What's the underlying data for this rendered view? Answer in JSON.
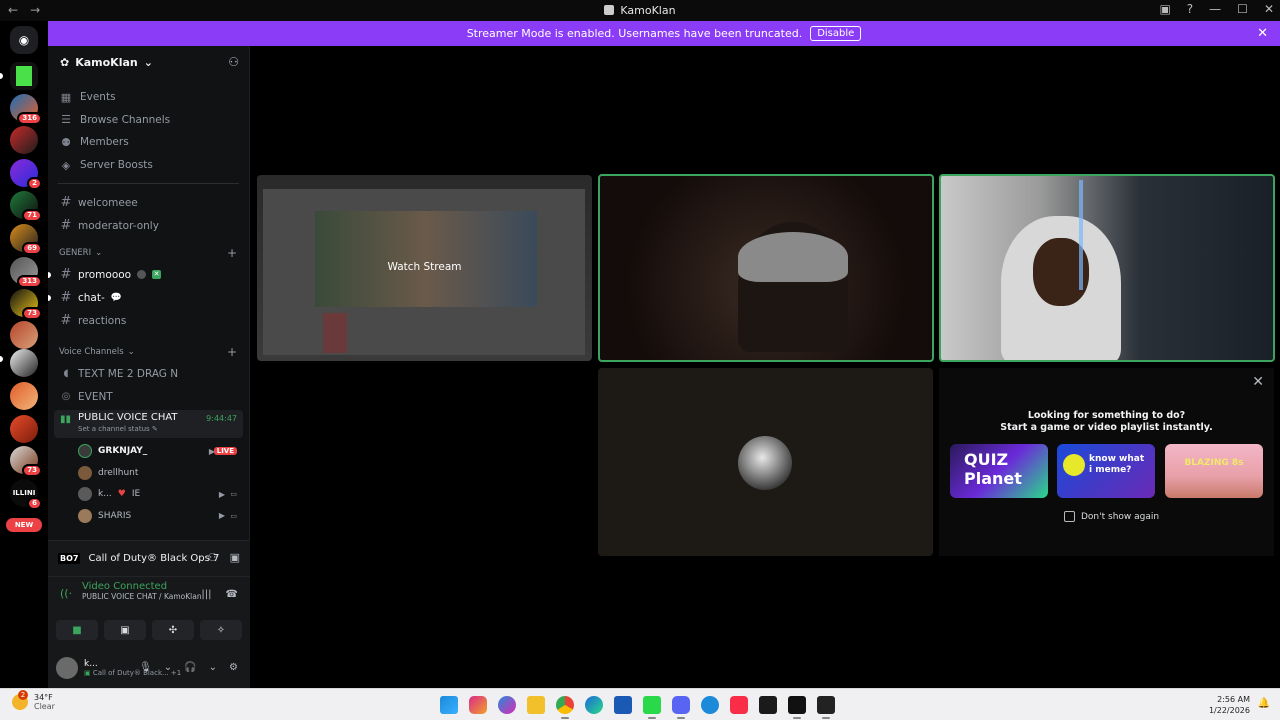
{
  "window": {
    "title": "KamoKlan"
  },
  "banner": {
    "text": "Streamer Mode is enabled. Usernames have been truncated.",
    "button": "Disable"
  },
  "server": {
    "name": "KamoKlan",
    "nav": [
      "Events",
      "Browse Channels",
      "Members",
      "Server Boosts"
    ]
  },
  "channels_top": [
    "welcomeee",
    "moderator-only"
  ],
  "category_text": {
    "name": "GENERI",
    "channels": [
      "promoooo",
      "chat-",
      "reactions"
    ]
  },
  "category_voice": {
    "name": "Voice Channels",
    "channels": [
      "TEXT ME 2 DRAG N",
      "EVENT"
    ]
  },
  "active_voice": {
    "name": "PUBLIC VOICE CHAT",
    "timer": "9:44:47",
    "status": "Set a channel status"
  },
  "voice_users": [
    {
      "name": "GRKNJAY_",
      "live": "LIVE"
    },
    {
      "name": "drellhunt"
    },
    {
      "name": "k...",
      "tag": "IE"
    },
    {
      "name": "SHARIS"
    }
  ],
  "server_badges": [
    "316",
    "2",
    "71",
    "69",
    "313",
    "73",
    "73",
    "6"
  ],
  "new_pill": "NEW",
  "game": {
    "name": "Call of Duty® Black Ops 7",
    "icon": "BO7"
  },
  "voice_connection": {
    "status": "Video Connected",
    "detail": "PUBLIC VOICE CHAT / KamoKlan"
  },
  "me": {
    "name": "k...",
    "activity": "Call of Duty® Black...",
    "extra": "+1"
  },
  "stage": {
    "watch_label": "Watch Stream"
  },
  "activity_prompt": {
    "line1": "Looking for something to do?",
    "line2": "Start a game or video playlist instantly.",
    "dont_show": "Don't show again",
    "cards": [
      "QUIZ Planet",
      "know what i meme?",
      "BLAZING 8s"
    ]
  },
  "taskbar": {
    "weather_temp": "34°F",
    "weather_desc": "Clear",
    "weather_badge": "2",
    "time": "2:56 AM",
    "date": "1/22/2026"
  }
}
